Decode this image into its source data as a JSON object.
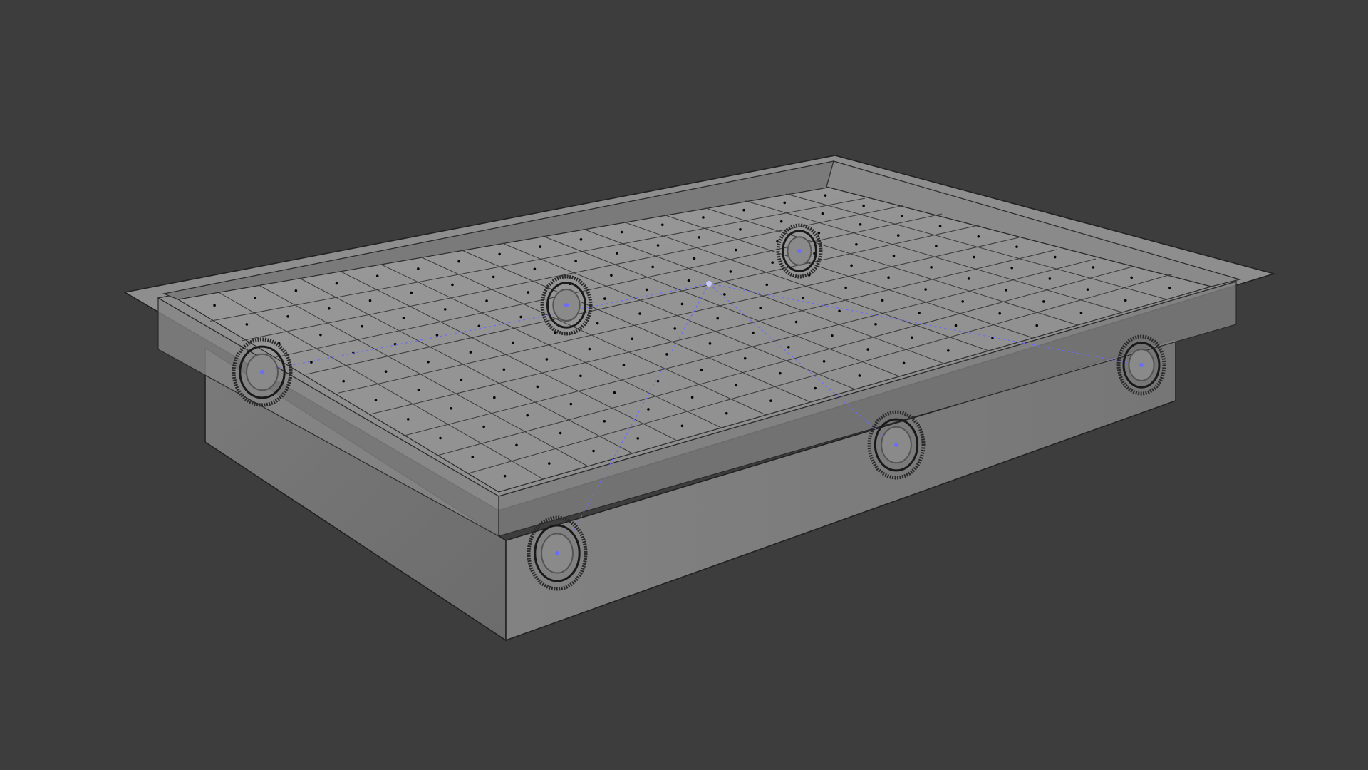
{
  "viewport": {
    "background_color": "#3d3d3d",
    "mode": "wireframe-xray"
  },
  "scene": {
    "object": "tray-mesh",
    "face_color": "#8a8a8a",
    "edge_color": "#1a1a1a",
    "vertex_color": "#050505",
    "bearing_count": 6,
    "highlight_color": "#6b6bff"
  }
}
